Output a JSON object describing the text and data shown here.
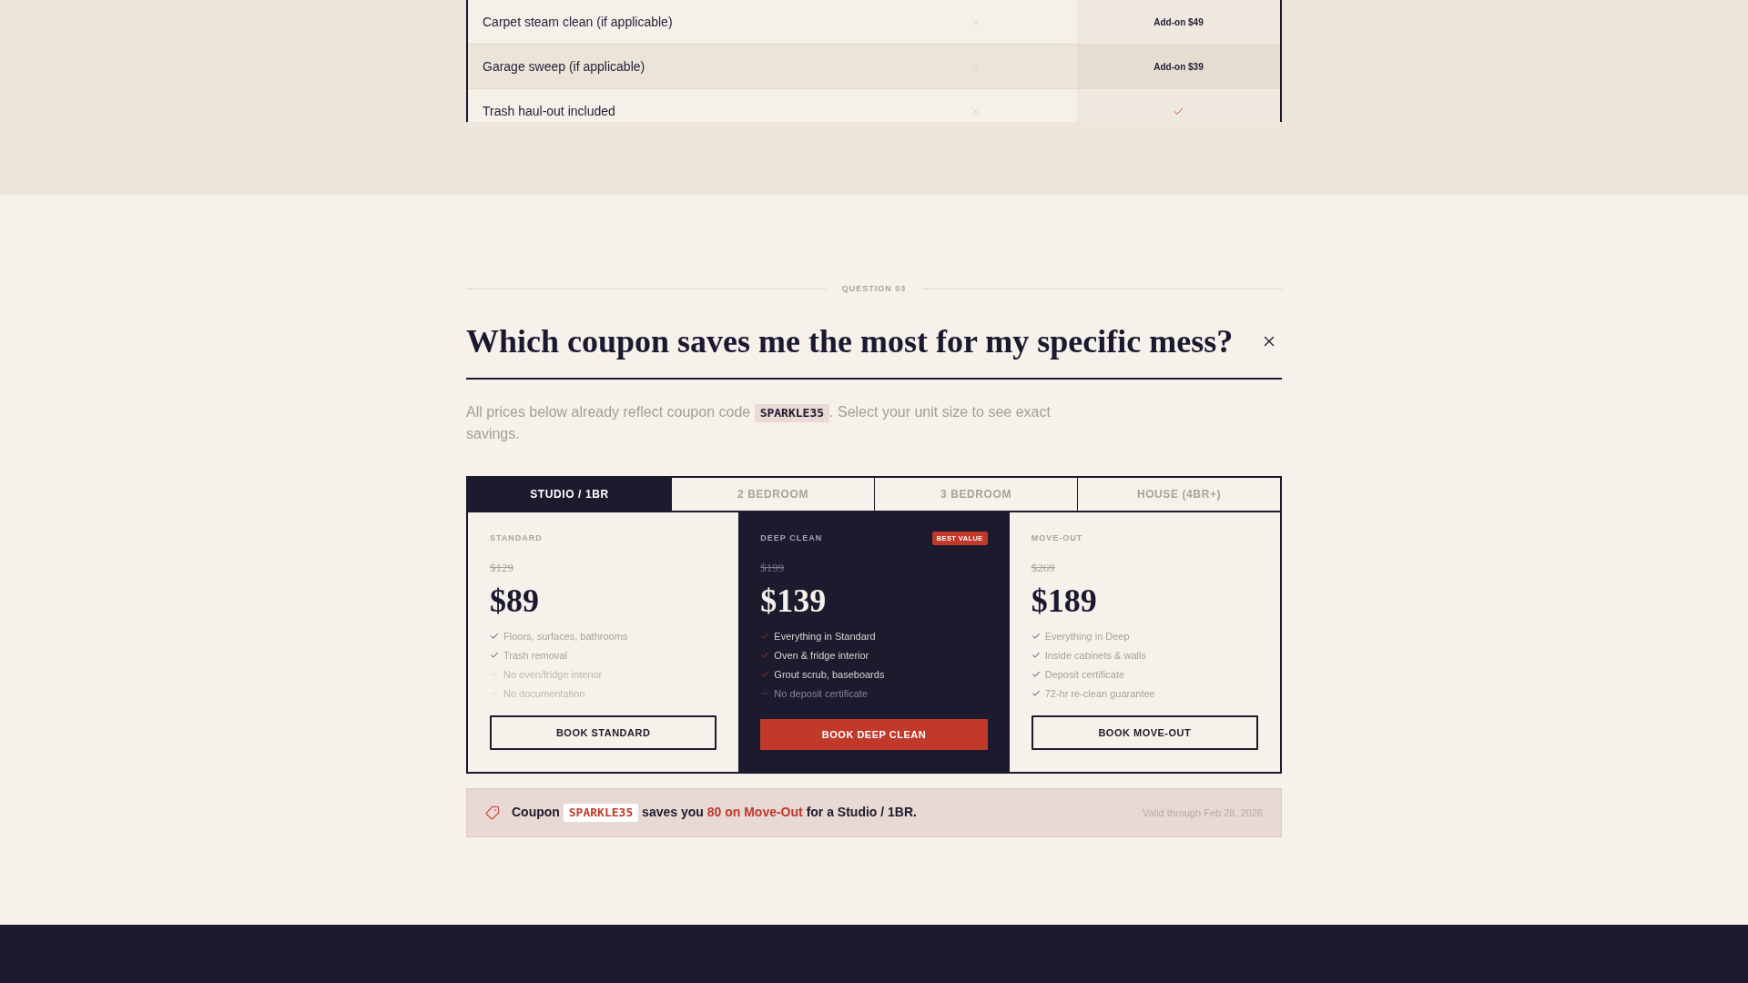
{
  "comparison_table": {
    "rows": [
      {
        "label": "Carpet steam clean (if applicable)",
        "cells": [
          {
            "kind": "cross"
          },
          {
            "kind": "text",
            "text": "Add-on $49"
          }
        ]
      },
      {
        "label": "Garage sweep (if applicable)",
        "cells": [
          {
            "kind": "cross"
          },
          {
            "kind": "text",
            "text": "Add-on $39"
          }
        ]
      },
      {
        "label": "Trash haul-out included",
        "cells": [
          {
            "kind": "cross"
          },
          {
            "kind": "check"
          }
        ]
      }
    ]
  },
  "question": {
    "eyebrow": "QUESTION 03",
    "title": "Which coupon saves me the most for my specific mess?",
    "intro": {
      "before": "All prices below already reflect coupon code",
      "code": "SPARKLE35",
      "after": ". Select your unit size to see exact savings."
    }
  },
  "tabs": [
    {
      "label": "STUDIO / 1BR",
      "selected": true
    },
    {
      "label": "2 BEDROOM",
      "selected": false
    },
    {
      "label": "3 BEDROOM",
      "selected": false
    },
    {
      "label": "HOUSE (4BR+)",
      "selected": false
    }
  ],
  "plans": [
    {
      "name": "STANDARD",
      "featured": false,
      "old_price": "$129",
      "price": "$89",
      "features": [
        {
          "text": "Floors, surfaces, bathrooms",
          "included": true
        },
        {
          "text": "Trash removal",
          "included": true
        },
        {
          "text": "No oven/fridge interior",
          "included": false
        },
        {
          "text": "No documentation",
          "included": false
        }
      ],
      "button": "BOOK STANDARD"
    },
    {
      "name": "DEEP CLEAN",
      "featured": true,
      "badge": "BEST VALUE",
      "old_price": "$199",
      "price": "$139",
      "features": [
        {
          "text": "Everything in Standard",
          "included": true
        },
        {
          "text": "Oven & fridge interior",
          "included": true
        },
        {
          "text": "Grout scrub, baseboards",
          "included": true
        },
        {
          "text": "No deposit certificate",
          "included": false
        }
      ],
      "button": "BOOK DEEP CLEAN"
    },
    {
      "name": "MOVE-OUT",
      "featured": false,
      "old_price": "$269",
      "price": "$189",
      "features": [
        {
          "text": "Everything in Deep",
          "included": true
        },
        {
          "text": "Inside cabinets & walls",
          "included": true
        },
        {
          "text": "Deposit certificate",
          "included": true
        },
        {
          "text": "72-hr re-clean guarantee",
          "included": true
        }
      ],
      "button": "BOOK MOVE-OUT"
    }
  ],
  "coupon_banner": {
    "lead": "Coupon",
    "code": "SPARKLE35",
    "middle": "saves you",
    "highlight": "80 on Move-Out",
    "tail": "for a Studio / 1BR.",
    "validity": "Valid through Feb 28, 2026"
  }
}
